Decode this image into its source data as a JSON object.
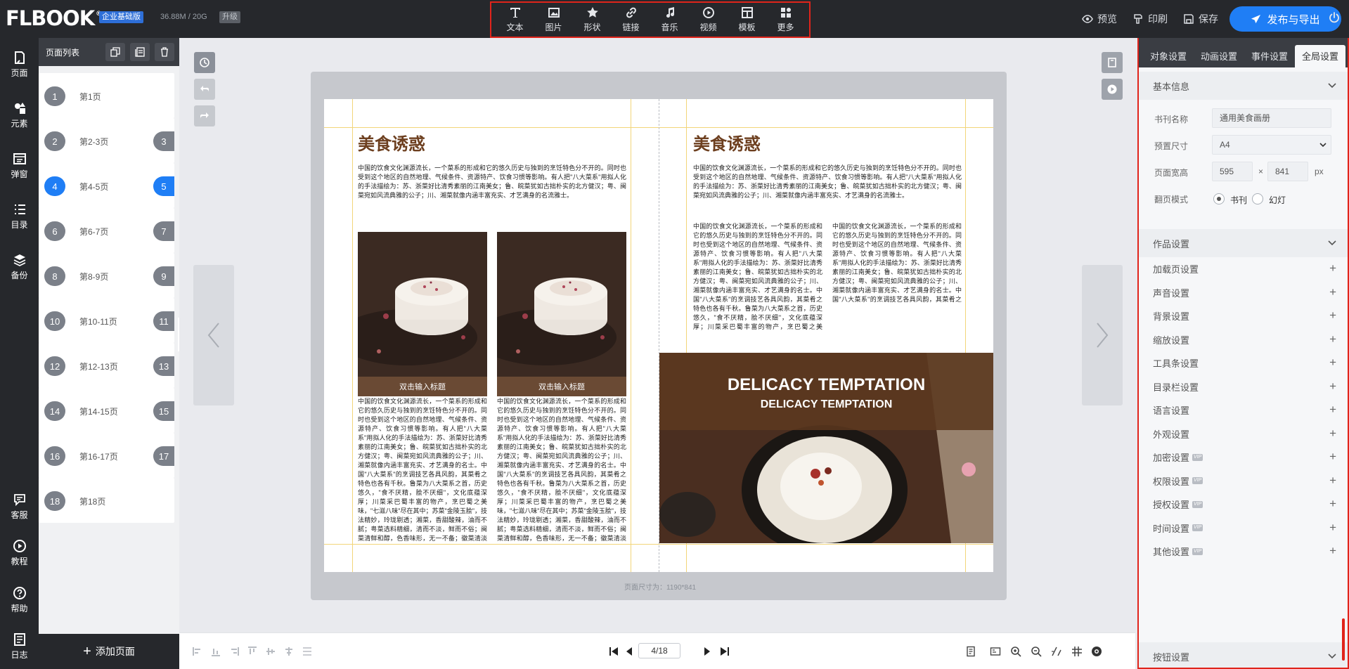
{
  "app": {
    "logo": "FLBOOK",
    "edition": "企业基础版",
    "storage": "36.88M / 20G",
    "upgrade": "升级"
  },
  "toolbar": {
    "items": [
      {
        "label": "文本",
        "icon": "text-icon"
      },
      {
        "label": "图片",
        "icon": "image-icon"
      },
      {
        "label": "形状",
        "icon": "star-icon"
      },
      {
        "label": "链接",
        "icon": "link-icon"
      },
      {
        "label": "音乐",
        "icon": "music-icon"
      },
      {
        "label": "视频",
        "icon": "video-icon"
      },
      {
        "label": "模板",
        "icon": "template-icon"
      },
      {
        "label": "更多",
        "icon": "more-icon"
      }
    ]
  },
  "top_actions": {
    "preview": "预览",
    "print": "印刷",
    "save": "保存",
    "publish": "发布与导出"
  },
  "rail": [
    {
      "label": "页面",
      "icon": "page-icon"
    },
    {
      "label": "元素",
      "icon": "elements-icon"
    },
    {
      "label": "弹窗",
      "icon": "popup-icon"
    },
    {
      "label": "目录",
      "icon": "catalog-icon"
    },
    {
      "label": "备份",
      "icon": "backup-icon"
    },
    {
      "label": "客服",
      "icon": "chat-icon"
    },
    {
      "label": "教程",
      "icon": "play-icon"
    },
    {
      "label": "帮助",
      "icon": "help-icon"
    },
    {
      "label": "日志",
      "icon": "log-icon"
    }
  ],
  "page_panel": {
    "title": "页面列表",
    "add_page": "添加页面",
    "pages": [
      {
        "left": "1",
        "right": "",
        "label": "第1页",
        "selected": false
      },
      {
        "left": "2",
        "right": "3",
        "label": "第2-3页",
        "selected": false
      },
      {
        "left": "4",
        "right": "5",
        "label": "第4-5页",
        "selected": true
      },
      {
        "left": "6",
        "right": "7",
        "label": "第6-7页",
        "selected": false
      },
      {
        "left": "8",
        "right": "9",
        "label": "第8-9页",
        "selected": false
      },
      {
        "left": "10",
        "right": "11",
        "label": "第10-11页",
        "selected": false
      },
      {
        "left": "12",
        "right": "13",
        "label": "第12-13页",
        "selected": false
      },
      {
        "left": "14",
        "right": "15",
        "label": "第14-15页",
        "selected": false
      },
      {
        "left": "16",
        "right": "17",
        "label": "第16-17页",
        "selected": false
      },
      {
        "left": "18",
        "right": "",
        "label": "第18页",
        "selected": false
      }
    ]
  },
  "book": {
    "left_title": "美食诱惑",
    "right_title": "美食诱惑",
    "intro": "中国的饮食文化渊源流长，一个菜系的形成和它的悠久历史与独到的烹饪特色分不开的。同时也受到这个地区的自然地理、气候条件、资源特产、饮食习惯等影响。有人把\"八大菜系\"用拟人化的手法描绘为：苏、浙菜好比清秀素丽的江南美女；鲁、皖菜犹如古拙朴实的北方健汉；粤、闽菜宛如风流典雅的公子；川、湘菜就像内涵丰富充实、才艺满身的名流雅士。",
    "body": "中国的饮食文化渊源流长，一个菜系的形成和它的悠久历史与独到的烹饪特色分不开的。同时也受到这个地区的自然地理、气候条件、资源特产、饮食习惯等影响。有人把\"八大菜系\"用拟人化的手法描绘为：苏、浙菜好比清秀素丽的江南美女；鲁、皖菜犹如古拙朴实的北方健汉；粤、闽菜宛如风流典雅的公子；川、湘菜就像内涵丰富充实、才艺满身的名士。中国\"八大菜系\"的烹调技艺各具风韵，其菜肴之特色也各有千秋。鲁菜为八大菜系之首，历史悠久，\"食不厌精，脍不厌细\"，文化底蕴深厚；川菜采巴蜀丰富的物产，烹巴蜀之美味，\"七滋八味\"尽在其中；苏菜\"金陵玉脍\"，技法精妙，玲珑剔透；湘菜，香甜酸辣，油而不腻；粤菜选料精细，清而不淡，鲜而不俗；闽菜清鲜和醇，色香味形，无一不备；徽菜清淡鲜活，博采众家，影响深远。",
    "caption1": "双击输入标题",
    "caption2": "双击输入标题",
    "hero_title": "DELICACY TEMPTATION",
    "hero_subtitle": "DELICACY TEMPTATION",
    "size_label": "页面尺寸为：1190*841"
  },
  "bottom": {
    "page_indicator": "4/18"
  },
  "right_panel": {
    "tabs": [
      "对象设置",
      "动画设置",
      "事件设置",
      "全局设置"
    ],
    "active_tab": 3,
    "basic_section": "基本信息",
    "fields": {
      "name_label": "书刊名称",
      "name_value": "通用美食画册",
      "size_label": "预置尺寸",
      "size_value": "A4",
      "wh_label": "页面宽高",
      "width": "595",
      "times": "×",
      "height": "841",
      "unit": "px",
      "flip_label": "翻页模式",
      "flip_book": "书刊",
      "flip_slide": "幻灯"
    },
    "work_section": "作品设置",
    "settings": [
      {
        "label": "加载页设置",
        "vip": false
      },
      {
        "label": "声音设置",
        "vip": false
      },
      {
        "label": "背景设置",
        "vip": false
      },
      {
        "label": "缩放设置",
        "vip": false
      },
      {
        "label": "工具条设置",
        "vip": false
      },
      {
        "label": "目录栏设置",
        "vip": false
      },
      {
        "label": "语言设置",
        "vip": false
      },
      {
        "label": "外观设置",
        "vip": false
      },
      {
        "label": "加密设置",
        "vip": true
      },
      {
        "label": "权限设置",
        "vip": true
      },
      {
        "label": "授权设置",
        "vip": true
      },
      {
        "label": "时间设置",
        "vip": true
      },
      {
        "label": "其他设置",
        "vip": true
      }
    ],
    "vip_badge": "VIP",
    "button_section": "按钮设置"
  },
  "colors": {
    "accent": "#1f7ef5",
    "highlight_border": "#e0241b",
    "dark_bar": "#26282c",
    "title_brown": "#6d3f1f"
  }
}
